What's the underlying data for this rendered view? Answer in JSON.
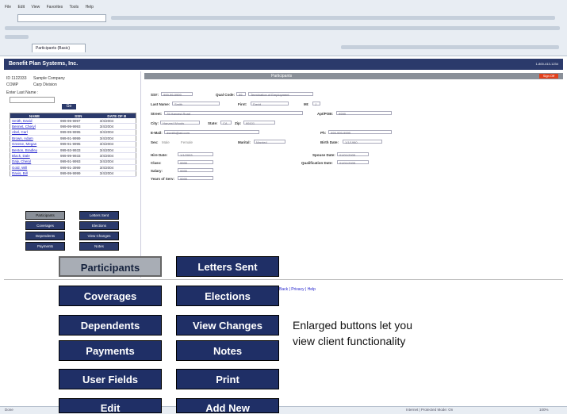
{
  "browser": {
    "menu": [
      "File",
      "Edit",
      "View",
      "Favorites",
      "Tools",
      "Help"
    ],
    "tab_label": "Participants (Basic)"
  },
  "app": {
    "title": "Benefit Plan Systems, Inc.",
    "header_right": "1-800-413-1234"
  },
  "left": {
    "company_id": "ID 1122333",
    "company_name": "Sample Company",
    "plan": "COMP",
    "plan_name": "Carp Division",
    "search_label": "Enter Last Name :",
    "go_label": "Go",
    "grid_headers": [
      "NAME",
      "SSN",
      "DATE OF B"
    ],
    "grid_rows": [
      [
        "Smith, David",
        "999-99-9997",
        "3/4/2004"
      ],
      [
        "Bennet, Cheryl",
        "999-99-9993",
        "3/4/2004"
      ],
      [
        "Abel, Carl",
        "999-99-9995",
        "3/4/2004"
      ],
      [
        "Brown, Adam",
        "999-91-9999",
        "3/4/2004"
      ],
      [
        "Greene, Megan",
        "999-91-9995",
        "3/4/2004"
      ],
      [
        "Benton, Bradley",
        "999-93-9933",
        "3/4/2004"
      ],
      [
        "Black, Dale",
        "999-99-9933",
        "3/4/2004"
      ],
      [
        "Daly, Cheryl",
        "999-91-9993",
        "3/4/2004"
      ],
      [
        "Gold, Will",
        "999-91-3999",
        "3/4/2004"
      ],
      [
        "Davis, Bill",
        "999-99-9999",
        "3/4/2004"
      ]
    ],
    "buttons": [
      "Participants",
      "Letters Sent",
      "Coverages",
      "Elections",
      "Dependents",
      "View Changes",
      "Payments",
      "Notes",
      "User Fields",
      "Print",
      "Edit",
      "Add New"
    ]
  },
  "right": {
    "section_title": "Participants",
    "exit_label": "Sign Off",
    "fields": {
      "ssn_label": "SS#:",
      "ssn": "999-99-9999",
      "qual_label": "Qual Code:",
      "qual": "99",
      "qual_desc": "Termination of Employment",
      "last_label": "Last Name:",
      "last": "Smith",
      "first_label": "First:",
      "first": "David",
      "mi_label": "MI:",
      "mi": "J",
      "street_label": "Street:",
      "street": "75 Harvest Road",
      "apt_label": "Apt/POB:",
      "apt": "9999",
      "city_label": "City:",
      "city": "Harvest Woods",
      "state_label": "State:",
      "state": "CA",
      "zip_label": "Zip:",
      "zip": "99101",
      "email_label": "E-Mail:",
      "email": "dsmith@ad.com",
      "ph_label": "Ph:",
      "ph": "999-999-9999",
      "sex_label": "Sex:",
      "sex_m": "Male",
      "sex_f": "Female",
      "marital_label": "Marital:",
      "marital": "Married",
      "birth_label": "Birth Date:",
      "birth": "1/1/1980",
      "hired_label": "Hire Date:",
      "hired": "1/1/2003",
      "spouse_label": "Spouse Date:",
      "spouse": "01/01/2005",
      "class_label": "Class:",
      "class": "9999",
      "qual_date_label": "Qualification Date:",
      "qual_date": "01/01/2005",
      "salary_label": "Salary:",
      "salary": "9999",
      "years_label": "Years of Serv:",
      "years": "9999"
    },
    "bottom_links": "Back | Privacy | Help"
  },
  "status": {
    "left": "Done",
    "zone": "Internet | Protected Mode: On",
    "zoom": "100%"
  },
  "enlarged": {
    "buttons": [
      "Participants",
      "Letters Sent",
      "Coverages",
      "Elections",
      "Dependents",
      "View Changes",
      "Payments",
      "Notes",
      "User Fields",
      "Print",
      "Edit",
      "Add New"
    ],
    "caption_line1": "Enlarged buttons let you",
    "caption_line2": "view client functionality"
  },
  "colors": {
    "navy": "#1f2f66",
    "selected_grey": "#a8adb5",
    "exit_red": "#e2401c"
  }
}
